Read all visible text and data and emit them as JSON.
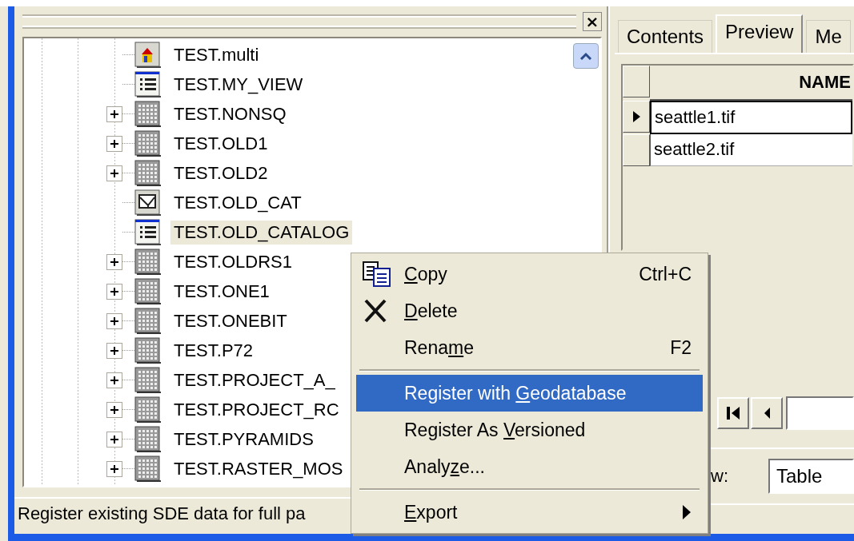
{
  "left_pane": {
    "close_button": {
      "label": "×"
    },
    "tree": {
      "items": [
        {
          "label": "TEST.multi",
          "kind": "multi",
          "expandable": false,
          "selected": false
        },
        {
          "label": "TEST.MY_VIEW",
          "kind": "view",
          "expandable": false,
          "selected": false
        },
        {
          "label": "TEST.NONSQ",
          "kind": "raster",
          "expandable": true,
          "selected": false
        },
        {
          "label": "TEST.OLD1",
          "kind": "raster",
          "expandable": true,
          "selected": false
        },
        {
          "label": "TEST.OLD2",
          "kind": "raster",
          "expandable": true,
          "selected": false
        },
        {
          "label": "TEST.OLD_CAT",
          "kind": "catalog",
          "expandable": false,
          "selected": false
        },
        {
          "label": "TEST.OLD_CATALOG",
          "kind": "view",
          "expandable": false,
          "selected": true
        },
        {
          "label": "TEST.OLDRS1",
          "kind": "raster",
          "expandable": true,
          "selected": false
        },
        {
          "label": "TEST.ONE1",
          "kind": "raster",
          "expandable": true,
          "selected": false
        },
        {
          "label": "TEST.ONEBIT",
          "kind": "raster",
          "expandable": true,
          "selected": false
        },
        {
          "label": "TEST.P72",
          "kind": "raster",
          "expandable": true,
          "selected": false
        },
        {
          "label": "TEST.PROJECT_A_",
          "kind": "raster",
          "expandable": true,
          "selected": false
        },
        {
          "label": "TEST.PROJECT_RC",
          "kind": "raster",
          "expandable": true,
          "selected": false
        },
        {
          "label": "TEST.PYRAMIDS",
          "kind": "raster",
          "expandable": true,
          "selected": false
        },
        {
          "label": "TEST.RASTER_MOS",
          "kind": "raster",
          "expandable": true,
          "selected": false
        }
      ]
    },
    "status_bar": "Register existing SDE data for full pa"
  },
  "right_pane": {
    "tabs": [
      {
        "label": "Contents",
        "selected": false
      },
      {
        "label": "Preview",
        "selected": true
      },
      {
        "label": "Me",
        "selected": false
      }
    ],
    "grid": {
      "columns": [
        "NAME"
      ],
      "rows": [
        {
          "cells": [
            "seattle1.tif"
          ],
          "selected": true
        },
        {
          "cells": [
            "seattle2.tif"
          ],
          "selected": false
        }
      ]
    },
    "preview_label": "w:",
    "preview_type": {
      "value": "Table"
    }
  },
  "context_menu": {
    "items": [
      {
        "kind": "copy",
        "access_key": "C",
        "after": "opy",
        "shortcut": "Ctrl+C",
        "selected": false,
        "submenu": false
      },
      {
        "kind": "delete",
        "access_key": "D",
        "after": "elete",
        "selected": false,
        "submenu": false
      },
      {
        "kind": "command",
        "before": "Rena",
        "access_key": "m",
        "after": "e",
        "shortcut": "F2",
        "selected": false,
        "submenu": false
      },
      {
        "kind": "separator"
      },
      {
        "kind": "command",
        "before": "Register with ",
        "access_key": "G",
        "after": "eodatabase",
        "selected": true,
        "submenu": false
      },
      {
        "kind": "command",
        "before": "Register As ",
        "access_key": "V",
        "after": "ersioned",
        "selected": false,
        "submenu": false
      },
      {
        "kind": "command",
        "before": "Analy",
        "access_key": "z",
        "after": "e...",
        "selected": false,
        "submenu": false
      },
      {
        "kind": "separator"
      },
      {
        "kind": "command",
        "access_key": "E",
        "after": "xport",
        "selected": false,
        "submenu": true
      }
    ]
  }
}
